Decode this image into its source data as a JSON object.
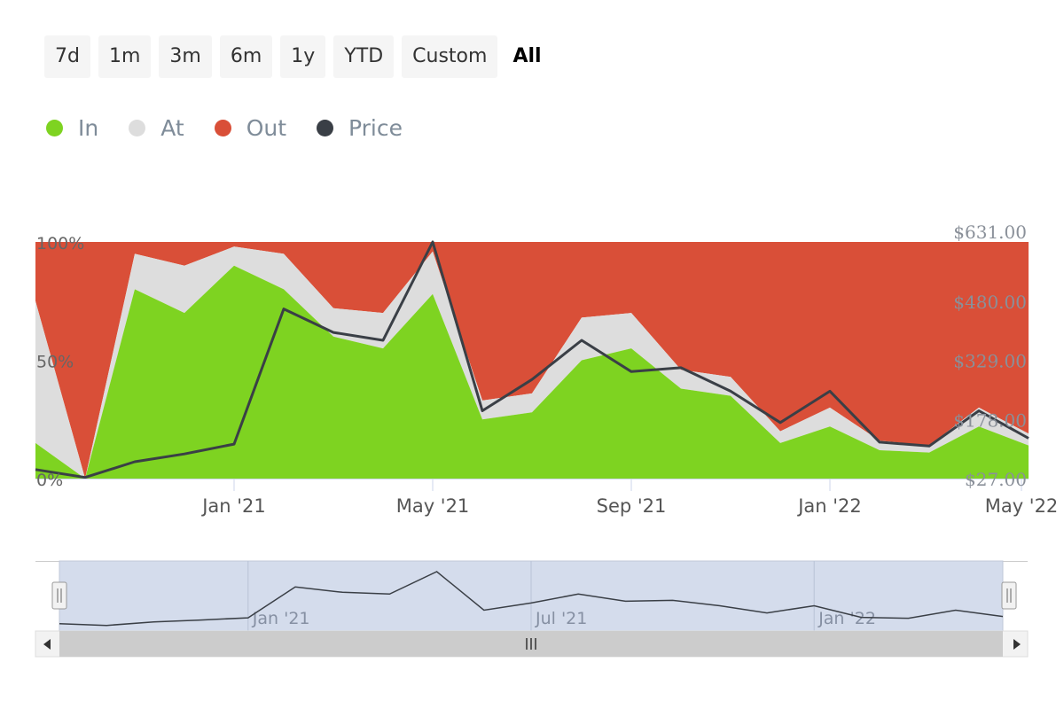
{
  "range_buttons": [
    "7d",
    "1m",
    "3m",
    "6m",
    "1y",
    "YTD",
    "Custom",
    "All"
  ],
  "active_range": "All",
  "legend": [
    {
      "label": "In",
      "color": "#7ed321"
    },
    {
      "label": "At",
      "color": "#dddddd"
    },
    {
      "label": "Out",
      "color": "#d94f38"
    },
    {
      "label": "Price",
      "color": "#3a3f46"
    }
  ],
  "chart_data": {
    "type": "area",
    "title": "",
    "x_ticks": [
      "Jan '21",
      "May '21",
      "Sep '21",
      "Jan '22",
      "May '22"
    ],
    "y_left_ticks": [
      "100%",
      "50%",
      "0%"
    ],
    "y_right_ticks": [
      "$631.00",
      "$480.00",
      "$329.00",
      "$178.00",
      "$27.00"
    ],
    "y_left_range": [
      0,
      100
    ],
    "y_right_range": [
      27,
      631
    ],
    "x_range": [
      "2020-09",
      "2022-05"
    ],
    "series": [
      {
        "name": "In",
        "color": "#7ed321",
        "x": [
          "2020-09",
          "2020-10",
          "2020-11",
          "2020-12",
          "2021-01",
          "2021-02",
          "2021-03",
          "2021-04",
          "2021-05",
          "2021-06",
          "2021-07",
          "2021-08",
          "2021-09",
          "2021-10",
          "2021-11",
          "2021-12",
          "2022-01",
          "2022-02",
          "2022-03",
          "2022-04",
          "2022-05"
        ],
        "values": [
          15,
          0,
          80,
          70,
          90,
          80,
          60,
          55,
          78,
          25,
          28,
          50,
          55,
          38,
          35,
          15,
          22,
          12,
          11,
          22,
          14
        ]
      },
      {
        "name": "At",
        "color": "#dddddd",
        "x": [
          "2020-09",
          "2020-10",
          "2020-11",
          "2020-12",
          "2021-01",
          "2021-02",
          "2021-03",
          "2021-04",
          "2021-05",
          "2021-06",
          "2021-07",
          "2021-08",
          "2021-09",
          "2021-10",
          "2021-11",
          "2021-12",
          "2022-01",
          "2022-02",
          "2022-03",
          "2022-04",
          "2022-05"
        ],
        "values": [
          60,
          0,
          15,
          20,
          8,
          15,
          12,
          15,
          18,
          8,
          8,
          18,
          15,
          8,
          8,
          5,
          8,
          4,
          3,
          8,
          5
        ]
      },
      {
        "name": "Out",
        "color": "#d94f38",
        "x": [
          "2020-09",
          "2020-10",
          "2020-11",
          "2020-12",
          "2021-01",
          "2021-02",
          "2021-03",
          "2021-04",
          "2021-05",
          "2021-06",
          "2021-07",
          "2021-08",
          "2021-09",
          "2021-10",
          "2021-11",
          "2021-12",
          "2022-01",
          "2022-02",
          "2022-03",
          "2022-04",
          "2022-05"
        ],
        "values": [
          25,
          100,
          5,
          10,
          2,
          5,
          28,
          30,
          4,
          67,
          64,
          32,
          30,
          54,
          57,
          80,
          70,
          84,
          86,
          70,
          81
        ]
      },
      {
        "name": "Price",
        "color": "#3a3f46",
        "x": [
          "2020-09",
          "2020-10",
          "2020-11",
          "2020-12",
          "2021-01",
          "2021-02",
          "2021-03",
          "2021-04",
          "2021-05",
          "2021-06",
          "2021-07",
          "2021-08",
          "2021-09",
          "2021-10",
          "2021-11",
          "2021-12",
          "2022-01",
          "2022-02",
          "2022-03",
          "2022-04",
          "2022-05"
        ],
        "values": [
          50,
          30,
          70,
          90,
          115,
          460,
          400,
          380,
          631,
          200,
          280,
          380,
          300,
          310,
          250,
          170,
          250,
          120,
          110,
          200,
          130
        ]
      }
    ],
    "navigator": {
      "x_ticks": [
        "Jan '21",
        "Jul '21",
        "Jan '22"
      ]
    }
  }
}
